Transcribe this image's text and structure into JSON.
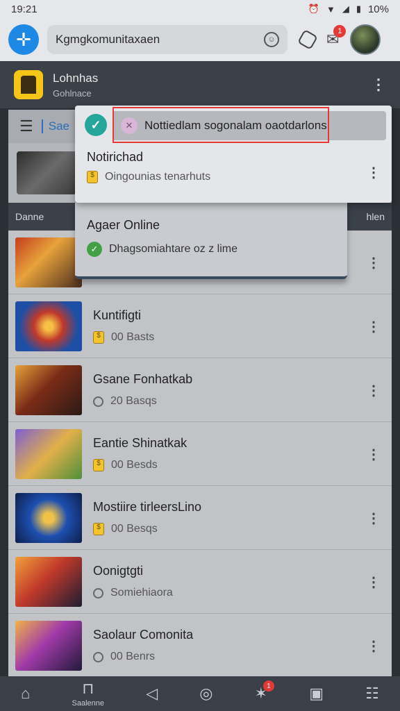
{
  "status": {
    "time": "19:21",
    "battery": "10%"
  },
  "topbar": {
    "search_value": "Kgmgkomunitaxaen",
    "search_prefix": "K"
  },
  "group": {
    "title": "Lohnhas",
    "subtitle": "Gohlnace"
  },
  "tabs": {
    "active": "Sae"
  },
  "section": {
    "left": "Danne",
    "right": "hlen"
  },
  "dropdown": {
    "chip_text": "Nottiedlam sogonalam oaotdarlons",
    "item1_title": "Notirichad",
    "item1_sub": "Oingounias tenarhuts",
    "item2_title": "Agaer Online",
    "item2_sub": "Dhagsomiahtare oz z lime"
  },
  "rows": [
    {
      "title": "",
      "meta": ""
    },
    {
      "title": "Kuntifigti",
      "meta": "00 Basts"
    },
    {
      "title": "Gsane Fonhatkab",
      "meta": "20 Basqs"
    },
    {
      "title": "Eantie Shinatkak",
      "meta": "00 Besds"
    },
    {
      "title": "Mostiire tirleersLino",
      "meta": "00 Besqs"
    },
    {
      "title": "Oonigtgti",
      "meta": "Somiehiaora"
    },
    {
      "title": "Saolaur Comonita",
      "meta": "00 Benrs"
    }
  ],
  "bottomnav": {
    "center_label": "Saalenne",
    "badge": "1",
    "topbar_badge": "1"
  }
}
